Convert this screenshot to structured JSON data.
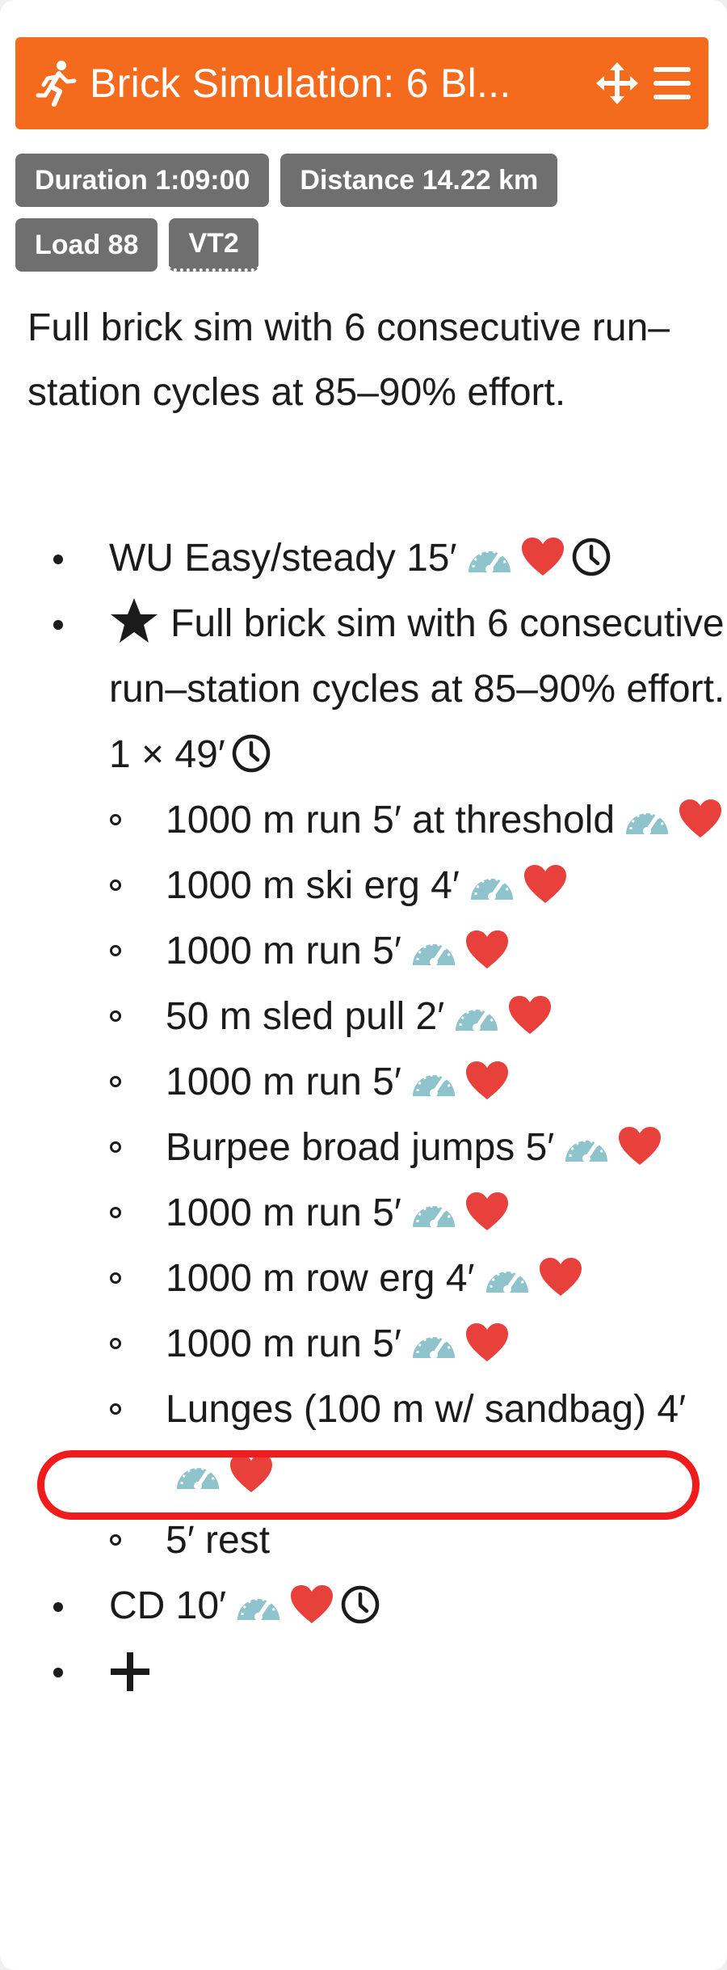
{
  "card": {
    "title": "Brick Simulation: 6 Bl...",
    "badges": {
      "duration": "Duration 1:09:00",
      "distance": "Distance 14.22 km",
      "load": "Load 88",
      "zone": "VT2"
    },
    "description": "Full brick sim with 6 consecutive run–station cycles at 85–90% effort."
  },
  "workout": {
    "warmup": "WU Easy/steady 15′",
    "main_set": "Full brick sim with 6 consecutive run–station cycles at 85–90% effort. 1 × 49′",
    "steps": [
      "1000 m run 5′ at threshold",
      "1000 m ski erg 4′",
      "1000 m run 5′",
      "50 m sled pull 2′",
      "1000 m run 5′",
      "Burpee broad jumps 5′",
      "1000 m run 5′",
      "1000 m row erg 4′",
      "1000 m run 5′",
      "Lunges (100 m w/ sandbag) 4′",
      "5′ rest"
    ],
    "cooldown": "CD 10′"
  },
  "icons": {
    "header": [
      "runner-icon",
      "move-icon",
      "menu-icon"
    ],
    "step": [
      "gauge-icon",
      "heart-icon",
      "clock-icon"
    ],
    "main_set": "star-icon",
    "add": "plus-icon"
  },
  "colors": {
    "header_bg": "#f56b1e",
    "badge_bg": "#6f6f6f",
    "gauge": "#8fc3cc",
    "heart": "#e8403a",
    "highlight": "#ee1c1c"
  }
}
